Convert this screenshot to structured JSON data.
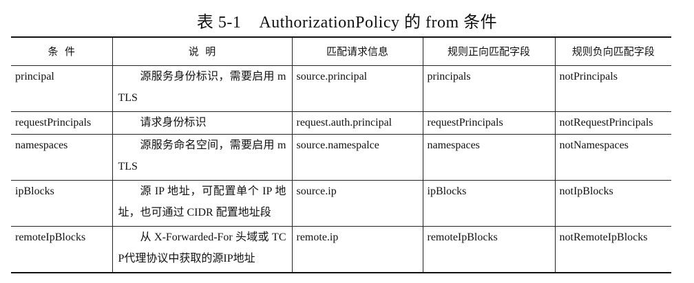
{
  "caption": "表 5-1    AuthorizationPolicy 的 from 条件",
  "columns": [
    "条  件",
    "说  明",
    "匹配请求信息",
    "规则正向匹配字段",
    "规则负向匹配字段"
  ],
  "rows": [
    {
      "condition": "principal",
      "description": "源服务身份标识，需要启用 mTLS",
      "request_info": "source.principal",
      "positive_field": "principals",
      "negative_field": "notPrincipals"
    },
    {
      "condition": "requestPrincipals",
      "description": "请求身份标识",
      "request_info": "request.auth.principal",
      "positive_field": "requestPrincipals",
      "negative_field": "notRequestPrincipals"
    },
    {
      "condition": "namespaces",
      "description": "源服务命名空间，需要启用 mTLS",
      "request_info": "source.namespalce",
      "positive_field": "namespaces",
      "negative_field": "notNamespaces"
    },
    {
      "condition": "ipBlocks",
      "description": "源 IP 地址，可配置单个 IP 地址，也可通过 CIDR 配置地址段",
      "request_info": "source.ip",
      "positive_field": "ipBlocks",
      "negative_field": "notIpBlocks"
    },
    {
      "condition": "remoteIpBlocks",
      "description": "从 X-Forwarded-For 头域或 TCP代理协议中获取的源IP地址",
      "request_info": "remote.ip",
      "positive_field": "remoteIpBlocks",
      "negative_field": "notRemoteIpBlocks"
    }
  ]
}
